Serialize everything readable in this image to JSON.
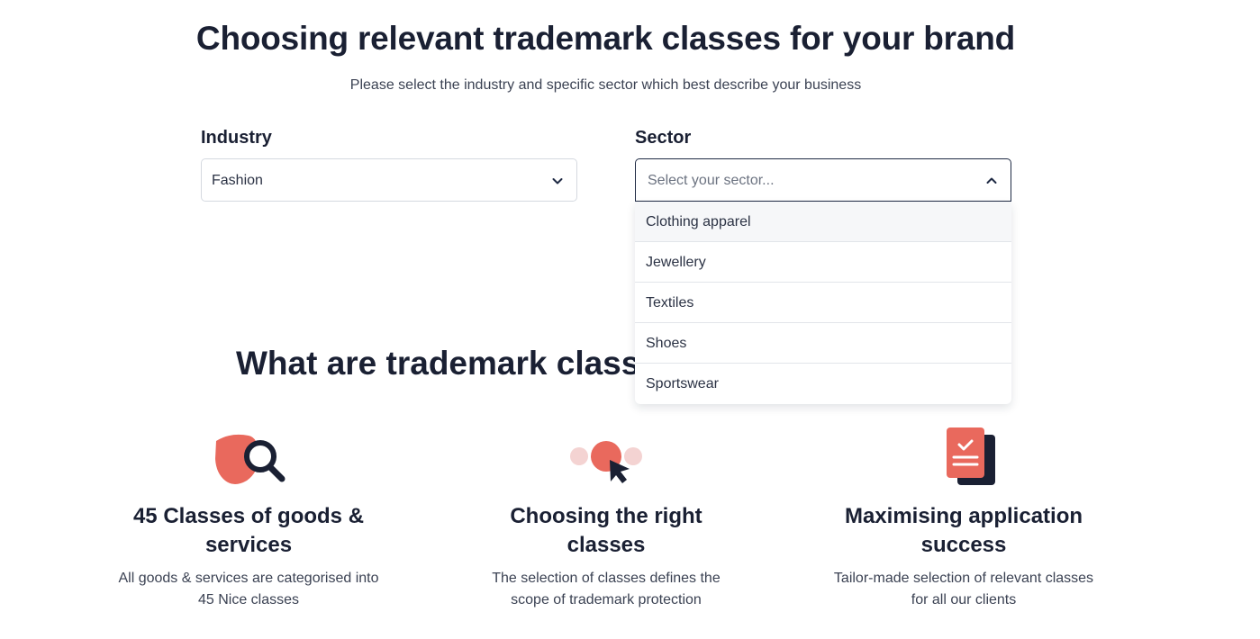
{
  "header": {
    "title": "Choosing relevant trademark classes for your brand",
    "subtitle": "Please select the industry and specific sector which best describe your business"
  },
  "industry": {
    "label": "Industry",
    "value": "Fashion"
  },
  "sector": {
    "label": "Sector",
    "placeholder": "Select your sector...",
    "options": [
      "Clothing apparel",
      "Jewellery",
      "Textiles",
      "Shoes",
      "Sportswear"
    ]
  },
  "section": {
    "title": "What are trademark classe"
  },
  "features": [
    {
      "icon": "magnifier-icon",
      "title": "45 Classes of goods & services",
      "text": "All goods & services are categorised into 45 Nice classes"
    },
    {
      "icon": "cursor-select-icon",
      "title": "Choosing the right classes",
      "text": "The selection of classes defines the scope of trademark protection"
    },
    {
      "icon": "clipboard-check-icon",
      "title": "Maximising application success",
      "text": "Tailor-made selection of relevant classes for all our clients"
    }
  ],
  "colors": {
    "accent": "#e9695d",
    "accent_light": "#f4d3d2",
    "dark": "#1a2033"
  }
}
